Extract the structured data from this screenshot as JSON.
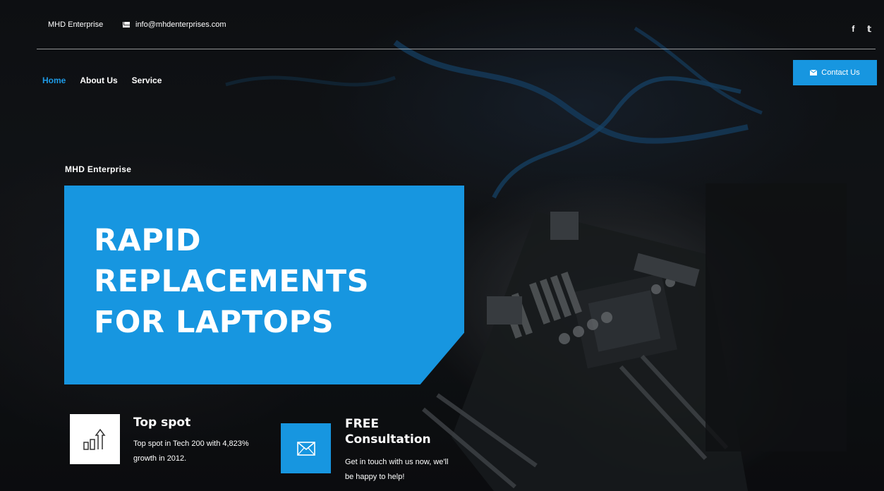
{
  "topbar": {
    "brand": "MHD Enterprise",
    "email": "info@mhdenterprises.com",
    "social": {
      "facebook": "f",
      "twitter": "𝕥"
    }
  },
  "nav": {
    "items": [
      {
        "label": "Home",
        "active": true
      },
      {
        "label": "About Us"
      },
      {
        "label": "Service"
      }
    ],
    "contact_label": "Contact Us"
  },
  "hero": {
    "eyebrow": "MHD Enterprise",
    "title_lines": [
      "RAPID",
      "REPLACEMENTS",
      "FOR LAPTOPS"
    ]
  },
  "features": [
    {
      "icon": "growth-chart-icon",
      "title": "Top spot",
      "text": "Top spot in Tech 200 with 4,823% growth in 2012."
    },
    {
      "icon": "envelope-icon",
      "title": "FREE Consultation",
      "text": "Get in touch with us now, we'll be happy to help!"
    }
  ],
  "colors": {
    "accent": "#1796e0",
    "nav_active": "#1e9be6"
  }
}
